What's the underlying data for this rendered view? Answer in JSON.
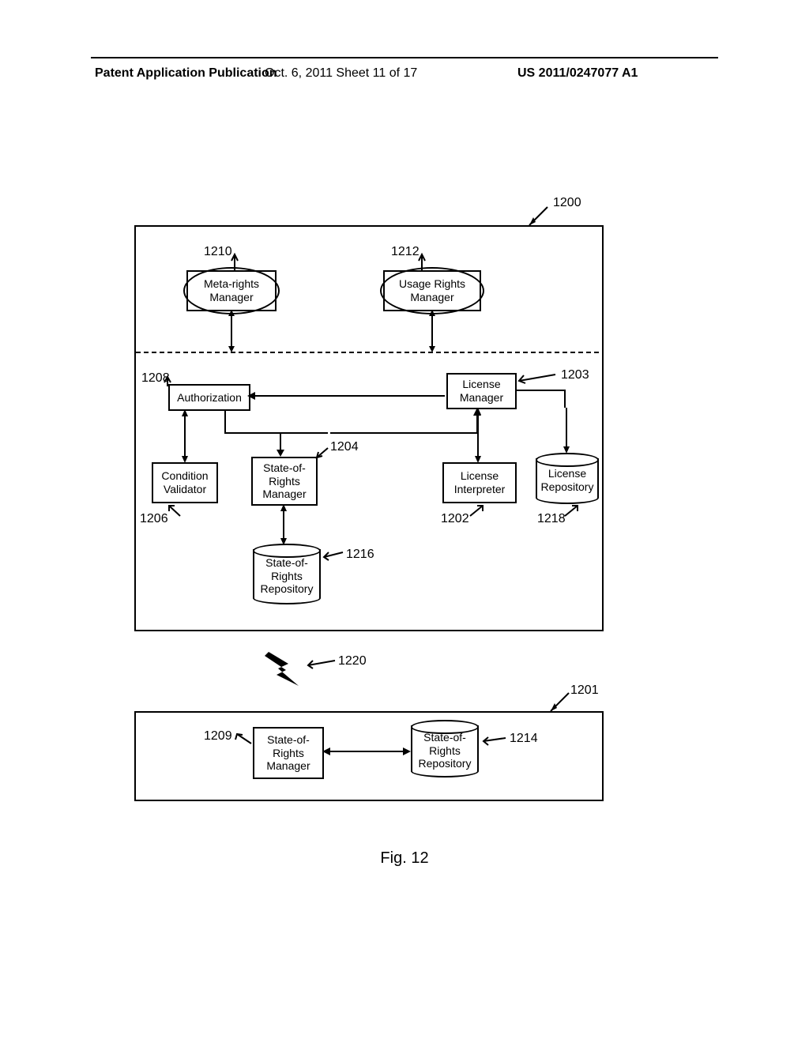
{
  "header": {
    "left": "Patent Application Publication",
    "mid": "Oct. 6, 2011   Sheet 11 of 17",
    "right": "US 2011/0247077 A1"
  },
  "figure_caption": "Fig. 12",
  "labels": {
    "l1200": "1200",
    "l1210": "1210",
    "l1212": "1212",
    "l1208": "1208",
    "l1203": "1203",
    "l1204": "1204",
    "l1206": "1206",
    "l1202": "1202",
    "l1218": "1218",
    "l1216": "1216",
    "l1220": "1220",
    "l1201": "1201",
    "l1209": "1209",
    "l1214": "1214"
  },
  "boxes": {
    "metarights": {
      "line1": "Meta-rights",
      "line2": "Manager"
    },
    "usagerights": {
      "line1": "Usage Rights",
      "line2": "Manager"
    },
    "authorization": {
      "line1": "Authorization"
    },
    "licensemgr": {
      "line1": "License",
      "line2": "Manager"
    },
    "condval": {
      "line1": "Condition",
      "line2": "Validator"
    },
    "sormgr": {
      "line1": "State-of-",
      "line2": "Rights",
      "line3": "Manager"
    },
    "licinterp": {
      "line1": "License",
      "line2": "Interpreter"
    },
    "licrepo": {
      "line1": "License",
      "line2": "Repository"
    },
    "sorrepo": {
      "line1": "State-of-",
      "line2": "Rights",
      "line3": "Repository"
    },
    "sormgr2": {
      "line1": "State-of-",
      "line2": "Rights",
      "line3": "Manager"
    },
    "sorrepo2": {
      "line1": "State-of-",
      "line2": "Rights",
      "line3": "Repository"
    }
  },
  "chart_data": {
    "type": "diagram",
    "title": "Fig. 12",
    "containers": [
      {
        "id": "1200",
        "label": "1200",
        "children": [
          "1210",
          "1212",
          "1208",
          "1203",
          "1204",
          "1206",
          "1202",
          "1218",
          "1216"
        ]
      },
      {
        "id": "1201",
        "label": "1201",
        "children": [
          "1209",
          "1214"
        ]
      }
    ],
    "nodes": [
      {
        "id": "1210",
        "name": "Meta-rights Manager",
        "shape": "box-with-ellipse"
      },
      {
        "id": "1212",
        "name": "Usage Rights Manager",
        "shape": "box-with-ellipse"
      },
      {
        "id": "1208",
        "name": "Authorization",
        "shape": "box"
      },
      {
        "id": "1203",
        "name": "License Manager",
        "shape": "box"
      },
      {
        "id": "1206",
        "name": "Condition Validator",
        "shape": "box"
      },
      {
        "id": "1204",
        "name": "State-of-Rights Manager",
        "shape": "box"
      },
      {
        "id": "1202",
        "name": "License Interpreter",
        "shape": "box"
      },
      {
        "id": "1218",
        "name": "License Repository",
        "shape": "cylinder"
      },
      {
        "id": "1216",
        "name": "State-of-Rights Repository",
        "shape": "cylinder"
      },
      {
        "id": "1220",
        "name": "Network Link",
        "shape": "lightning"
      },
      {
        "id": "1209",
        "name": "State-of-Rights Manager",
        "shape": "box"
      },
      {
        "id": "1214",
        "name": "State-of-Rights Repository",
        "shape": "cylinder"
      }
    ],
    "edges": [
      {
        "from": "1210",
        "to": "dashed-divider",
        "dir": "both"
      },
      {
        "from": "1212",
        "to": "dashed-divider",
        "dir": "both"
      },
      {
        "from": "1208",
        "to": "1203",
        "dir": "from-1203-to-1208"
      },
      {
        "from": "1208",
        "to": "1206",
        "dir": "both"
      },
      {
        "from": "1208",
        "to": "1204",
        "dir": "from-1208-to-1204"
      },
      {
        "from": "1203",
        "to": "1202",
        "dir": "both"
      },
      {
        "from": "1203",
        "to": "1218",
        "dir": "from-1203-to-1218"
      },
      {
        "from": "split",
        "to": "1203",
        "dir": "to-1203",
        "note": "elbow from mid-left"
      },
      {
        "from": "1204",
        "to": "1216",
        "dir": "both"
      },
      {
        "from": "1209",
        "to": "1214",
        "dir": "both"
      },
      {
        "from": "1200",
        "to": "1201",
        "via": "1220"
      }
    ]
  }
}
